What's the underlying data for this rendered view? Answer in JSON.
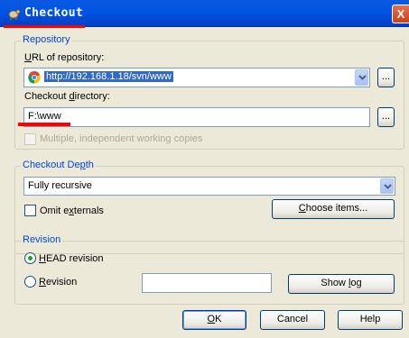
{
  "window": {
    "title": "Checkout",
    "close_glyph": "X"
  },
  "repository": {
    "group_label": "Repository",
    "url_label": "URL of repository:",
    "url_value": "http://192.168.1.18/svn/www",
    "browse_url_label": "...",
    "dir_label": "Checkout directory:",
    "dir_value": "F:\\www",
    "browse_dir_label": "...",
    "multiple_label": "Multiple, independent working copies"
  },
  "depth": {
    "group_label": "Checkout Depth",
    "depth_value": "Fully recursive",
    "omit_externals_label": "Omit externals",
    "choose_items_label": "Choose items..."
  },
  "revision": {
    "group_label": "Revision",
    "head_label": "HEAD revision",
    "revision_label": "Revision",
    "revision_value": "",
    "show_log_label": "Show log"
  },
  "buttons": {
    "ok": "OK",
    "cancel": "Cancel",
    "help": "Help"
  },
  "colors": {
    "titlebar": "#0055e5",
    "annotation_red": "#ff0000",
    "group_label": "#0046d5"
  }
}
